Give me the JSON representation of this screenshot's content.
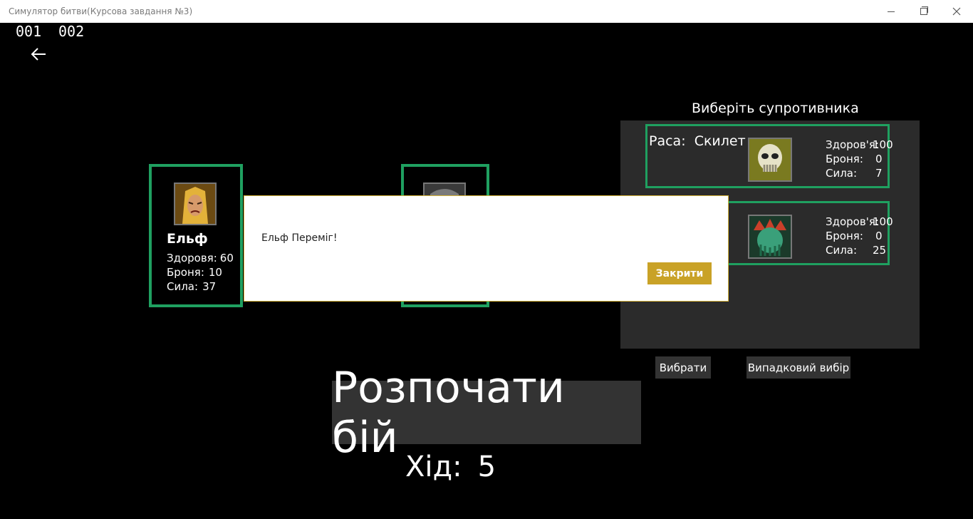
{
  "window": {
    "title": "Симулятор битви(Курсова завдання №3)"
  },
  "counters": [
    "001",
    "002"
  ],
  "player": {
    "name": "Ельф",
    "stats": [
      {
        "label": "Здоровя:",
        "value": "60"
      },
      {
        "label": "Броня:",
        "value": "10"
      },
      {
        "label": "Сила:",
        "value": "37"
      }
    ]
  },
  "opponents_panel": {
    "title": "Виберіть  супротивника",
    "opponents": [
      {
        "race_label": "Раса:",
        "race": "Скилет",
        "stats": [
          {
            "label": "Здоров'я:",
            "value": "100"
          },
          {
            "label": "Броня:",
            "value": "0"
          },
          {
            "label": "Сила:",
            "value": "7"
          }
        ]
      },
      {
        "stats": [
          {
            "label": "Здоров'я:",
            "value": "100"
          },
          {
            "label": "Броня:",
            "value": "0"
          },
          {
            "label": "Сила:",
            "value": "25"
          }
        ]
      }
    ],
    "select_label": "Вибрати",
    "random_label": "Випадковий вибір"
  },
  "start_label": "Розпочати бій",
  "turn": {
    "label": "Хід:",
    "value": "5"
  },
  "dialog": {
    "message": "Ельф Переміг!",
    "close_label": "Закрити"
  },
  "colors": {
    "card_border": "#1fa060",
    "dialog_button": "#c9a227",
    "panel_bg": "#2b2b2b"
  }
}
